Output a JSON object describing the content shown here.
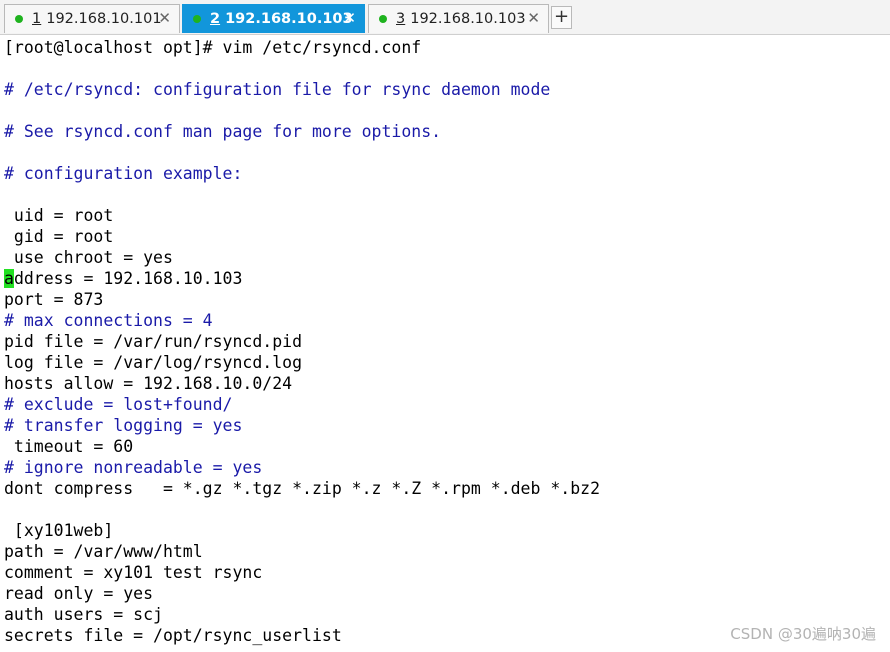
{
  "tabs": [
    {
      "num": "1",
      "label": "192.168.10.101",
      "close": "✕"
    },
    {
      "num": "2",
      "label": "192.168.10.103",
      "close": "✕"
    },
    {
      "num": "3",
      "label": "192.168.10.103",
      "close": "✕"
    }
  ],
  "add_tab": "+",
  "terminal": {
    "l0": "[root@localhost opt]# vim /etc/rsyncd.conf",
    "l1": "",
    "l2": "# /etc/rsyncd: configuration file for rsync daemon mode",
    "l3": "",
    "l4": "# See rsyncd.conf man page for more options.",
    "l5": "",
    "l6": "# configuration example:",
    "l7": "",
    "l8": " uid = root",
    "l9": " gid = root",
    "l10": " use chroot = yes",
    "l11_cursor": "a",
    "l11_rest": "ddress = 192.168.10.103",
    "l12": "port = 873",
    "l13": "# max connections = 4",
    "l14": "pid file = /var/run/rsyncd.pid",
    "l15": "log file = /var/log/rsyncd.log",
    "l16": "hosts allow = 192.168.10.0/24",
    "l17": "# exclude = lost+found/",
    "l18": "# transfer logging = yes",
    "l19": " timeout = 60",
    "l20": "# ignore nonreadable = yes",
    "l21": "dont compress   = *.gz *.tgz *.zip *.z *.Z *.rpm *.deb *.bz2",
    "l22": "",
    "l23": " [xy101web]",
    "l24": "path = /var/www/html",
    "l25": "comment = xy101 test rsync",
    "l26": "read only = yes",
    "l27": "auth users = scj",
    "l28": "secrets file = /opt/rsync_userlist"
  },
  "watermark": "CSDN @30遍呐30遍",
  "colors": {
    "accent": "#1296db",
    "comment": "#1a1aa8",
    "cursor": "#22e022",
    "status_dot": "#1fb31f"
  }
}
